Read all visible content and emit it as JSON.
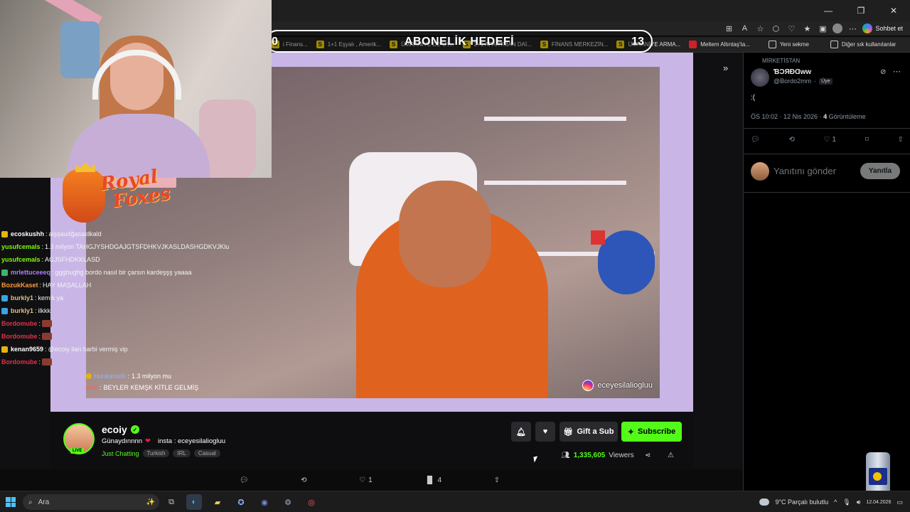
{
  "browser": {
    "copilot_label": "Sohbet et",
    "bookmarks": [
      {
        "label": "i Finans...",
        "icon": "yellow-s"
      },
      {
        "label": "1+1 Eşyalı , Amerik...",
        "icon": "yellow-s"
      },
      {
        "label": "ÜMRANİYE DE UY...",
        "icon": "yellow-s"
      },
      {
        "label": "2+1 APARTMAN DAİ...",
        "icon": "yellow-s"
      },
      {
        "label": "FİNANS MERKEZİN...",
        "icon": "yellow-s"
      },
      {
        "label": "ÜMRANİYE ARMA...",
        "icon": "yellow-s"
      },
      {
        "label": "Meltem Altıntaş'ta...",
        "icon": "red"
      },
      {
        "label": "Yeni sekme",
        "icon": "tab"
      },
      {
        "label": "Diğer sık kullanılanlar",
        "icon": "folder"
      }
    ]
  },
  "goal": {
    "title": "ABONELİK HEDEFİ",
    "left_value": "0",
    "right_value": "13"
  },
  "logo": {
    "line1": "Royal",
    "line2": "Foxes"
  },
  "chat": [
    {
      "user": "ecoskushh",
      "color": "#ffffff",
      "badge": "gold",
      "message": "alşşaudğasaldkald"
    },
    {
      "user": "yusufcemals",
      "color": "#7CFC00",
      "badge": "",
      "message": "1.3 milyon TAHGJYSHDGAJGTSFDHKVJKASLDASHGDKVJKlu"
    },
    {
      "user": "yusufcemals",
      "color": "#7CFC00",
      "badge": "",
      "message": "AGJSFHDKKLASD"
    },
    {
      "user": "mrlettuceeeq",
      "color": "#b07cff",
      "badge": "green",
      "message": "ggghughg bordo nasıl bir çarsın kardeşşş yaaaa"
    },
    {
      "user": "BozukKaset",
      "color": "#ff9a3c",
      "badge": "",
      "message": "HAY MAŞALLAH"
    },
    {
      "user": "burkly1",
      "color": "#e0c080",
      "badge": "blue",
      "message": "kemik ya"
    },
    {
      "user": "burkly1",
      "color": "#e0c080",
      "badge": "blue",
      "message": "ilkkk"
    },
    {
      "user": "Bordomube",
      "color": "#e0324a",
      "badge": "",
      "message": ""
    },
    {
      "user": "Bordomube",
      "color": "#e0324a",
      "badge": "",
      "message": ""
    },
    {
      "user": "kenan9659",
      "color": "#ffffff",
      "badge": "gold",
      "message": "@ecoiy ilan harbi vermiş vip"
    },
    {
      "user": "Bordomube",
      "color": "#e0324a",
      "badge": "",
      "message": ""
    }
  ],
  "video_chat": [
    {
      "user": "Hunkaristik",
      "message": "1.3 milyon mu"
    },
    {
      "user": "ozzi",
      "message": "BEYLER KEMŞK KİTLE GELMİŞ"
    }
  ],
  "video": {
    "watermark": "eceyesilaliogluu"
  },
  "channel": {
    "name": "ecoiy",
    "live_label": "LIVE",
    "title_text": "Günaydınnnn",
    "title_extra": "insta : eceyesilaliogluu",
    "category": "Just Chatting",
    "tags": [
      "Turkish",
      "IRL",
      "Casual"
    ],
    "gift_label": "Gift a Sub",
    "subscribe_label": "Subscribe",
    "viewers_count": "1,335,605",
    "viewers_label": "Viewers"
  },
  "tweet_bar": {
    "like_count": "1",
    "views_count": "4"
  },
  "x_panel": {
    "community": "MİRKETİSTAN",
    "name": "ƁƆЯÐⱭww",
    "handle": "@Bordo2mm",
    "role": "Üye",
    "text": ":(",
    "time": "ÖS 10:02 · 12 Nis 2026 · ",
    "views_num": "4",
    "views_label": "Görüntüleme",
    "like_count": "1",
    "reply_placeholder": "Yanıtını gönder",
    "reply_button": "Yanıtla"
  },
  "taskbar": {
    "search_placeholder": "Ara",
    "weather": "9°C  Parçalı bulutlu",
    "date": "12.04.2026"
  },
  "colors": {
    "kick_green": "#53fc18",
    "x_bg": "#000000",
    "taskbar": "#1c1c1c"
  }
}
